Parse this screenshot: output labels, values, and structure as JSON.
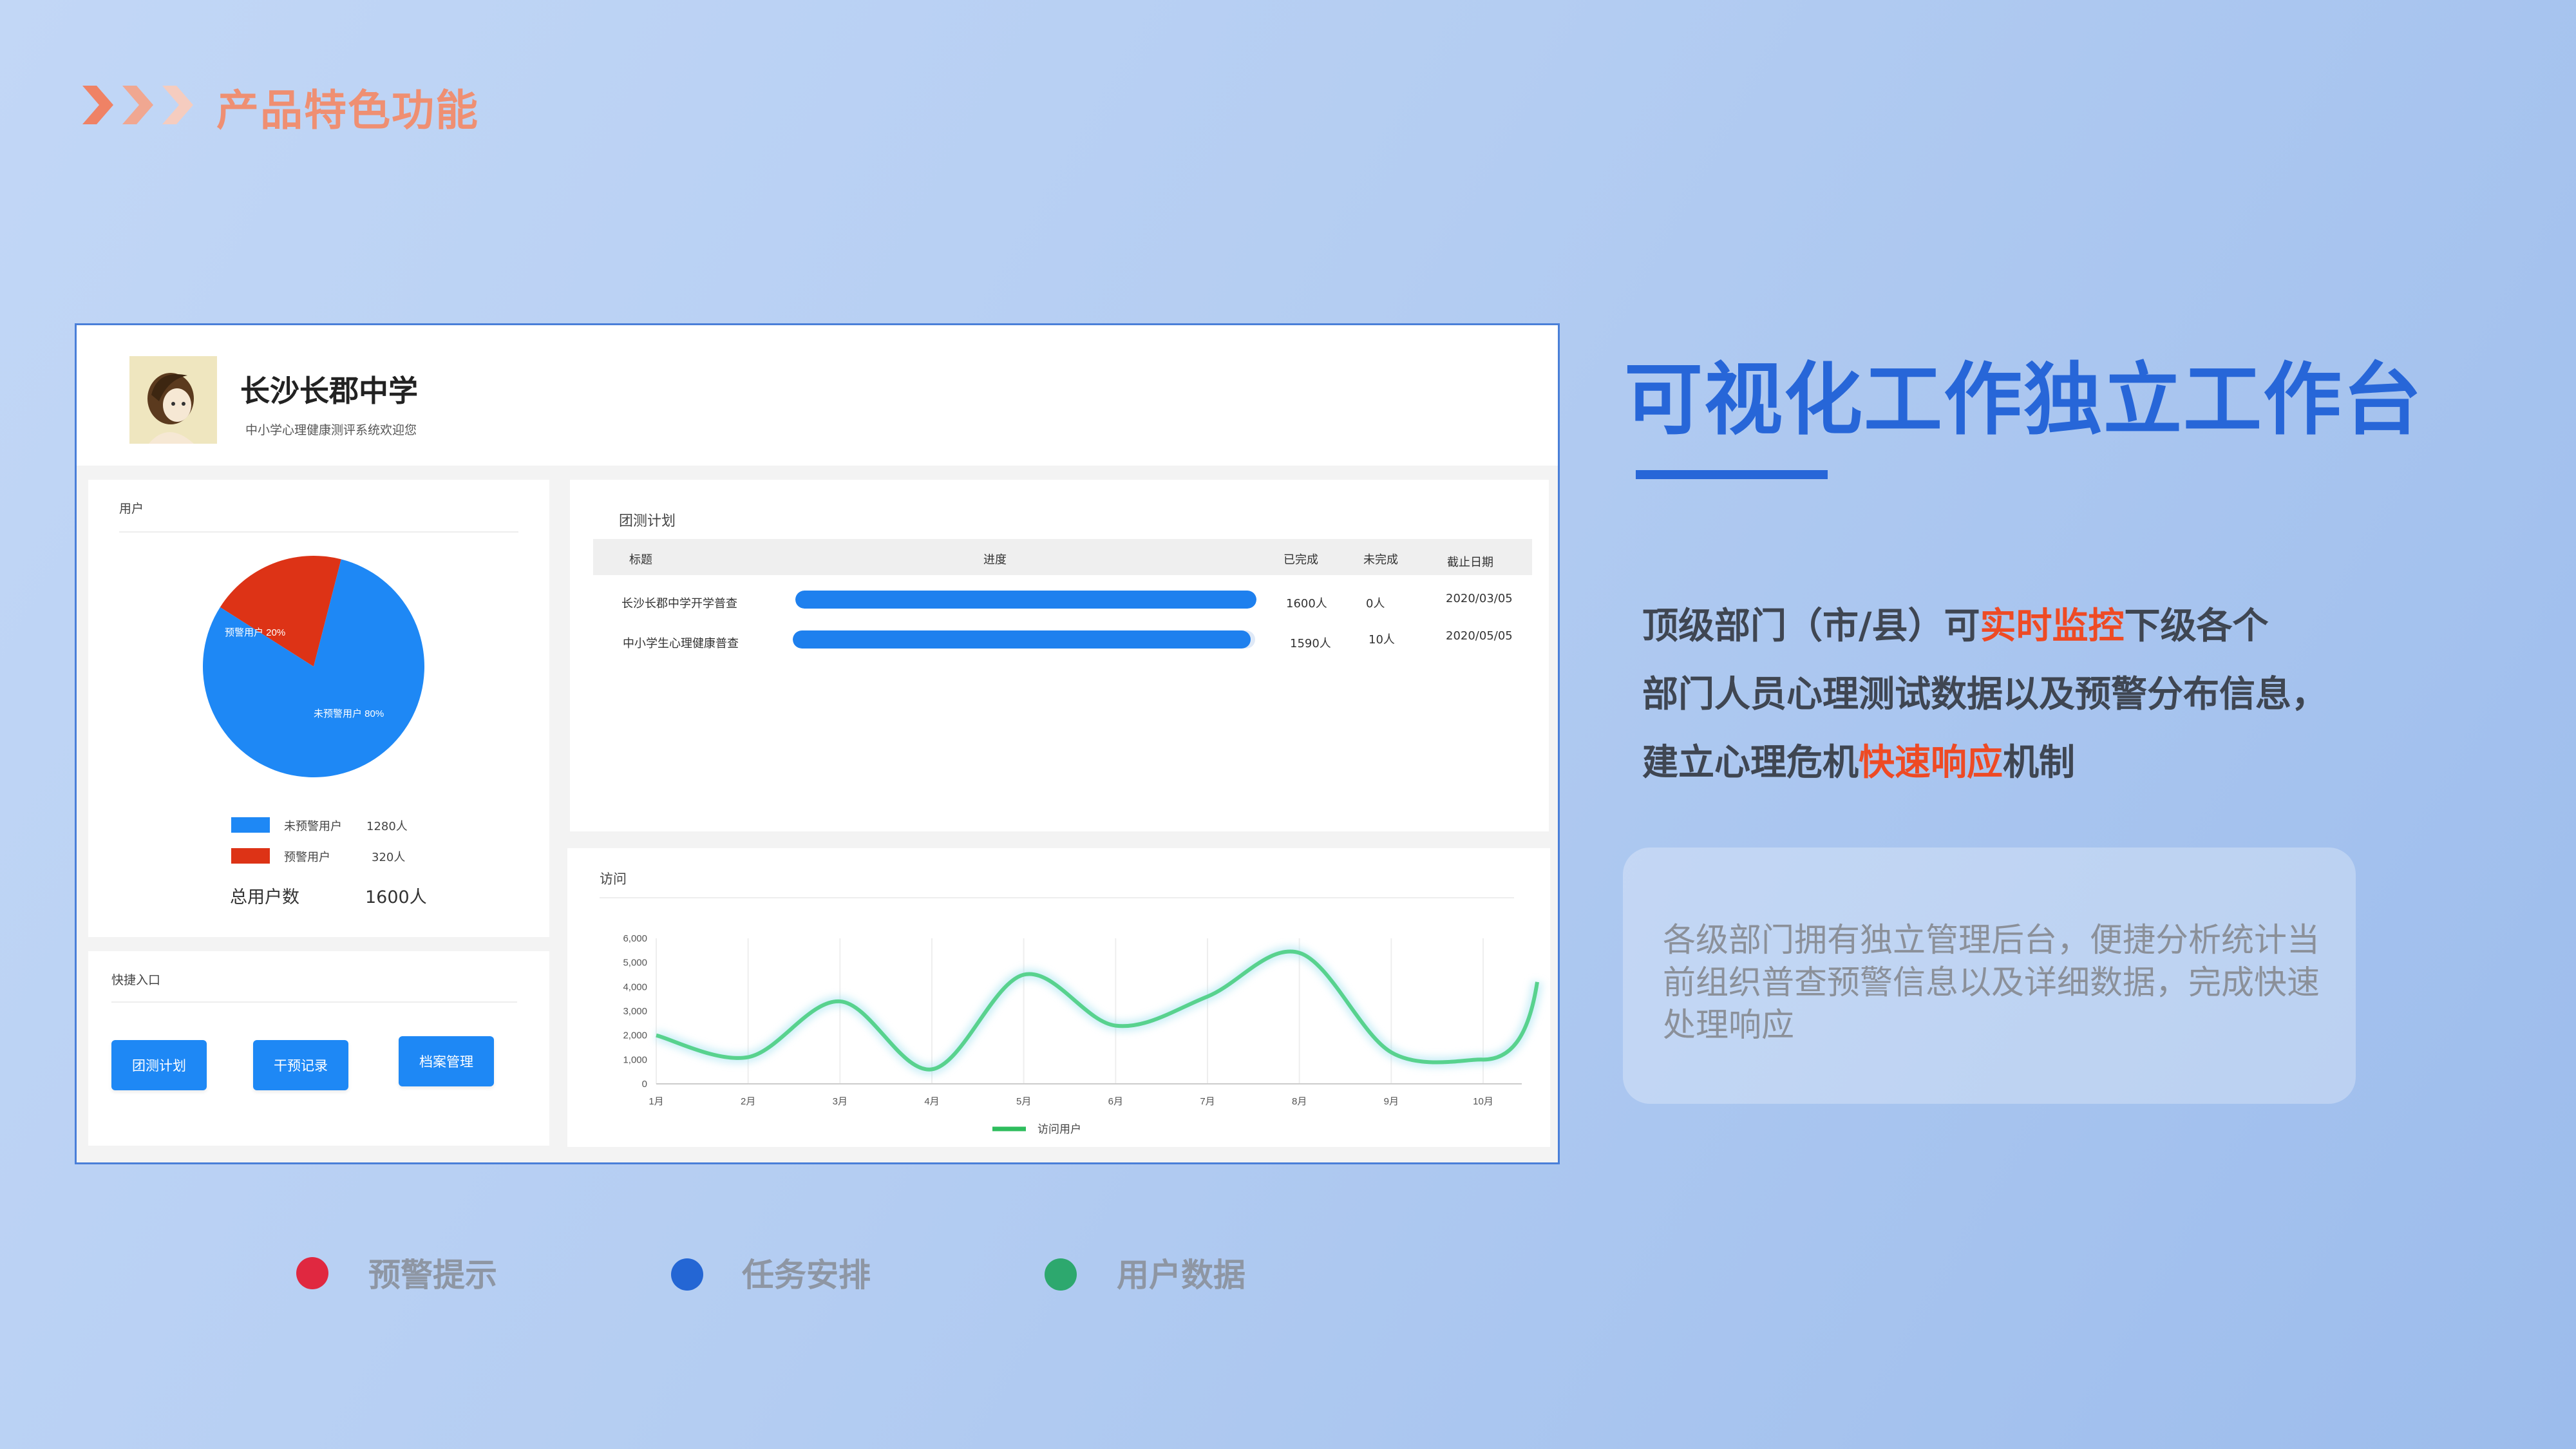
{
  "page_title": "产品特色功能",
  "dashboard": {
    "school_name": "长沙长郡中学",
    "school_subtitle": "中小学心理健康测评系统欢迎您",
    "users_card": {
      "title": "用户",
      "pie_label_warning": "预警用户 20%",
      "pie_label_normal": "未预警用户 80%",
      "legend": [
        {
          "name": "未预警用户",
          "count": "1280人",
          "color": "#1e88f5"
        },
        {
          "name": "预警用户",
          "count": "320人",
          "color": "#dd3316"
        }
      ],
      "total_label": "总用户数",
      "total_value": "1600人"
    },
    "quick_entry": {
      "title": "快捷入口",
      "buttons": [
        "团测计划",
        "干预记录",
        "档案管理"
      ]
    },
    "plan_table": {
      "title": "团测计划",
      "headers": [
        "标题",
        "进度",
        "已完成",
        "未完成",
        "截止日期"
      ],
      "rows": [
        {
          "title": "长沙长郡中学开学普查",
          "progress": 1.0,
          "done": "1600人",
          "undone": "0人",
          "deadline": "2020/03/05"
        },
        {
          "title": "中小学生心理健康普查",
          "progress": 0.99,
          "done": "1590人",
          "undone": "10人",
          "deadline": "2020/05/05"
        }
      ]
    },
    "visits_card": {
      "title": "访问",
      "legend_label": "访问用户"
    }
  },
  "chart_data": [
    {
      "type": "pie",
      "categories": [
        "预警用户",
        "未预警用户"
      ],
      "values": [
        20,
        80
      ],
      "colors": [
        "#dd3316",
        "#1e88f5"
      ]
    },
    {
      "type": "line",
      "x": [
        "1月",
        "2月",
        "3月",
        "4月",
        "5月",
        "6月",
        "7月",
        "8月",
        "9月",
        "10月"
      ],
      "series": [
        {
          "name": "访问用户",
          "values": [
            2000,
            1100,
            3400,
            600,
            4500,
            2400,
            3600,
            5400,
            1300,
            1000
          ],
          "color": "#4ccf86"
        }
      ],
      "yticks": [
        "0",
        "1,000",
        "2,000",
        "3,000",
        "4,000",
        "5,000",
        "6,000"
      ],
      "ylim": [
        0,
        6000
      ],
      "grid": true,
      "legend_position": "bottom"
    }
  ],
  "headline": "可视化工作独立工作台",
  "description": {
    "line1_a": "顶级部门（市/县）可",
    "line1_hl": "实时监控",
    "line1_b": "下级各个",
    "line2": "部门人员心理测试数据以及预警分布信息，",
    "line3_a": "建立心理危机",
    "line3_hl": "快速响应",
    "line3_b": "机制"
  },
  "info_text": "各级部门拥有独立管理后台，便捷分析统计当前组织普查预警信息以及详细数据，完成快速处理响应",
  "bottom_legend": [
    {
      "label": "预警提示",
      "color": "#e02840"
    },
    {
      "label": "任务安排",
      "color": "#2466d4"
    },
    {
      "label": "用户数据",
      "color": "#2da86e"
    }
  ]
}
